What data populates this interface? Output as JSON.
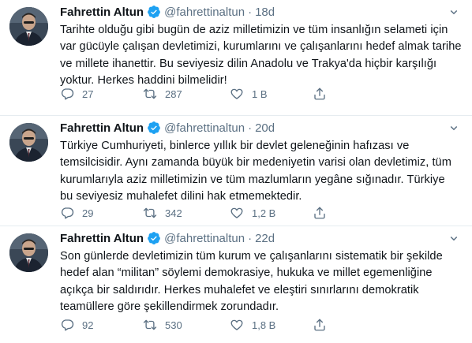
{
  "colors": {
    "verified": "#1da1f2",
    "secondary": "#5b7083",
    "text": "#0f1419",
    "divider": "#e6ecf0"
  },
  "tweets": [
    {
      "name": "Fahrettin Altun",
      "handle": "@fahrettinaltun",
      "separator": "·",
      "time": "18d",
      "text": "Tarihte olduğu gibi bugün de aziz milletimizin ve tüm insanlığın selameti için\nvar gücüyle çalışan devletimizi, kurumlarını ve çalışanlarını hedef almak tarihe\nve millete ihanettir. Bu seviyesiz dilin Anadolu ve Trakya'da hiçbir karşılığı\nyoktur. Herkes haddini bilmelidir!",
      "replies": "27",
      "retweets": "287",
      "likes": "1 B"
    },
    {
      "name": "Fahrettin Altun",
      "handle": "@fahrettinaltun",
      "separator": "·",
      "time": "20d",
      "text": "Türkiye Cumhuriyeti, binlerce yıllık bir devlet geleneğinin hafızası ve\ntemsilcisidir. Aynı zamanda büyük bir medeniyetin varisi olan devletimiz, tüm\nkurumlarıyla aziz milletimizin ve tüm mazlumların yegâne sığınadır. Türkiye\nbu seviyesiz muhalefet dilini hak etmemektedir.",
      "replies": "29",
      "retweets": "342",
      "likes": "1,2 B"
    },
    {
      "name": "Fahrettin Altun",
      "handle": "@fahrettinaltun",
      "separator": "·",
      "time": "22d",
      "text": "Son günlerde devletimizin tüm kurum ve çalışanlarını sistematik bir şekilde\nhedef alan “militan” söylemi demokrasiye, hukuka ve millet egemenliğine\naçıkça bir saldırıdır. Herkes muhalefet ve eleştiri sınırlarını demokratik\nteamüllere göre şekillendirmek zorundadır.",
      "replies": "92",
      "retweets": "530",
      "likes": "1,8 B"
    }
  ]
}
